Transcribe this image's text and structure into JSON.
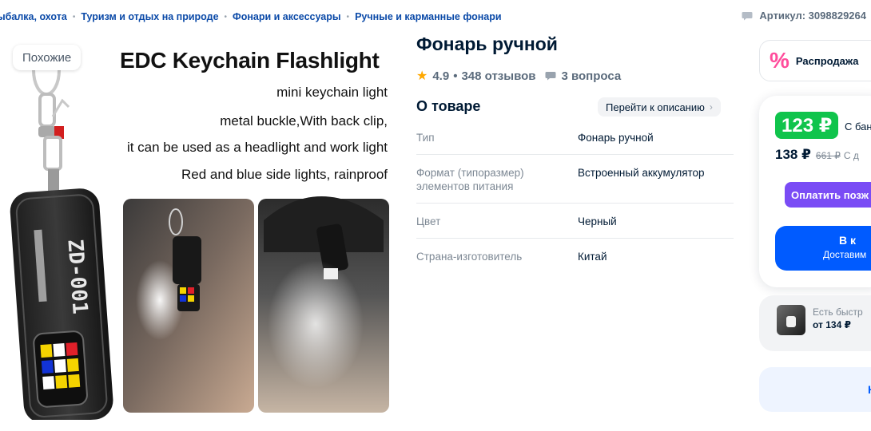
{
  "breadcrumbs": [
    "ыбалка, охота",
    "Туризм и отдых на природе",
    "Фонари и аксессуары",
    "Ручные и карманные фонари"
  ],
  "article": "Артикул: 3098829264",
  "image": {
    "similar_label": "Похожие",
    "promo_title": "EDC Keychain Flashlight",
    "promo_lines": [
      "mini keychain light",
      "metal buckle,With back clip,",
      "it can be used as a headlight and work light",
      "Red and blue side lights, rainproof"
    ],
    "device_text": "ZD-001"
  },
  "product": {
    "title": "Фонарь ручной",
    "rating": "4.9",
    "reviews": "348 отзывов",
    "questions": "3 вопроса",
    "about_title": "О товаре",
    "goto_description": "Перейти к описанию",
    "specs": [
      {
        "key": "Тип",
        "value": "Фонарь ручной"
      },
      {
        "key": "Формат (типоразмер) элементов питания",
        "value": "Встроенный аккумулятор"
      },
      {
        "key": "Цвет",
        "value": "Черный"
      },
      {
        "key": "Страна-изготовитель",
        "value": "Китай"
      }
    ]
  },
  "sidebar": {
    "sale_icon": "%",
    "sale_label": "Распродажа",
    "price_main": "123 ₽",
    "price_main_note": "С бан",
    "price_second": "138 ₽",
    "price_old": "661 ₽",
    "price_second_note": "С д",
    "pay_later": "Оплатить позж",
    "cart_line1": "В к",
    "cart_line2": "Доставим",
    "fast_text": "Есть быстр",
    "fast_price": "от 134 ₽",
    "bottom_label": "Н"
  },
  "colors": {
    "accent": "#005bff",
    "price_green": "#10c44c",
    "pay_purple": "#7a4cf5",
    "star": "#ffa800",
    "sale_pink": "#ff4d9c"
  }
}
